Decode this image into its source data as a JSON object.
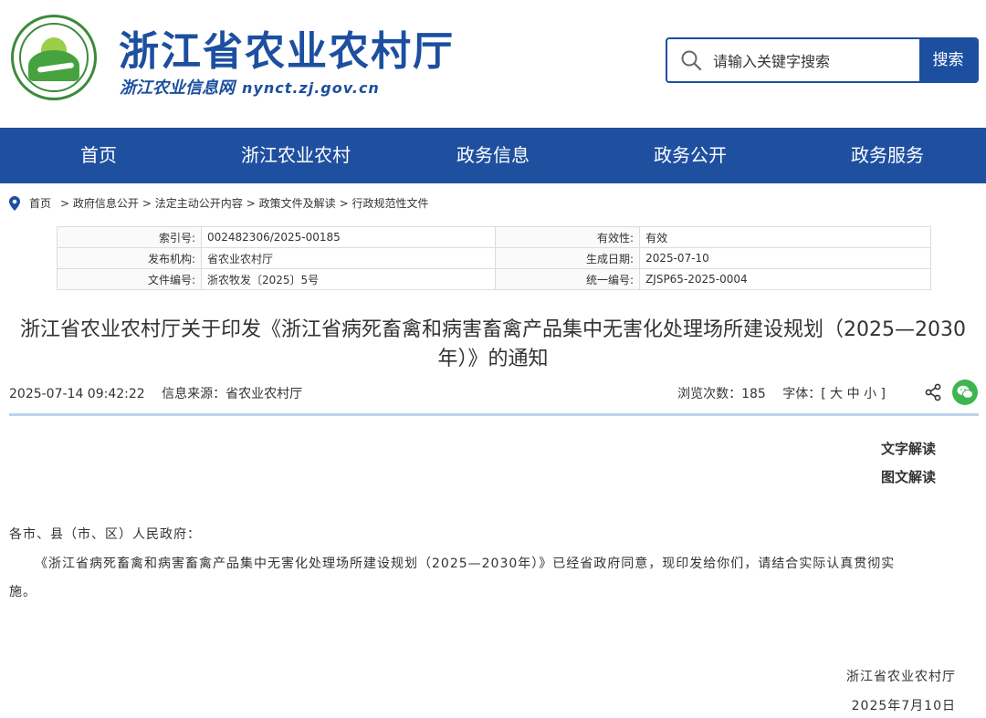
{
  "header": {
    "site_title": "浙江省农业农村厅",
    "site_subtitle": "浙江农业信息网",
    "site_url": "nynct.zj.gov.cn",
    "search_placeholder": "请输入关键字搜索",
    "search_button": "搜索"
  },
  "nav": [
    "首页",
    "浙江农业农村",
    "政务信息",
    "政务公开",
    "政务服务"
  ],
  "breadcrumb": {
    "home": "首页",
    "path": [
      "> 政府信息公开",
      "> 法定主动公开内容",
      "> 政策文件及解读",
      "> 行政规范性文件"
    ]
  },
  "info": {
    "index_key": "索引号:",
    "index_val": "002482306/2025-00185",
    "validity_key": "有效性:",
    "validity_val": "有效",
    "org_key": "发布机构:",
    "org_val": "省农业农村厅",
    "date_key": "生成日期:",
    "date_val": "2025-07-10",
    "docno_key": "文件编号:",
    "docno_val": "浙农牧发〔2025〕5号",
    "unino_key": "统一编号:",
    "unino_val": "ZJSP65-2025-0004"
  },
  "doc": {
    "title_line1": "浙江省农业农村厅关于印发《浙江省病死畜禽和病害畜禽产品集中无害化处理场所建设规划（2025—2030",
    "title_line2": "年）》的通知",
    "datetime": "2025-07-14 09:42:22",
    "source": "信息来源：省农业农村厅",
    "views": "浏览次数：185",
    "font_label": "字体：[ 大 中 小 ]",
    "interp_text": "文字解读",
    "interp_image": "图文解读",
    "greeting": "各市、县（市、区）人民政府：",
    "para1": "《浙江省病死畜禽和病害畜禽产品集中无害化处理场所建设规划（2025—2030年）》已经省政府同意，现印发给你们，请结合实际认真贯彻实",
    "para1_cont": "施。",
    "sign_org": "浙江省农业农村厅",
    "sign_date": "2025年7月10日"
  },
  "colors": {
    "brand": "#1c4fa0",
    "nav": "#1f4f9f",
    "wechat": "#3db650"
  }
}
